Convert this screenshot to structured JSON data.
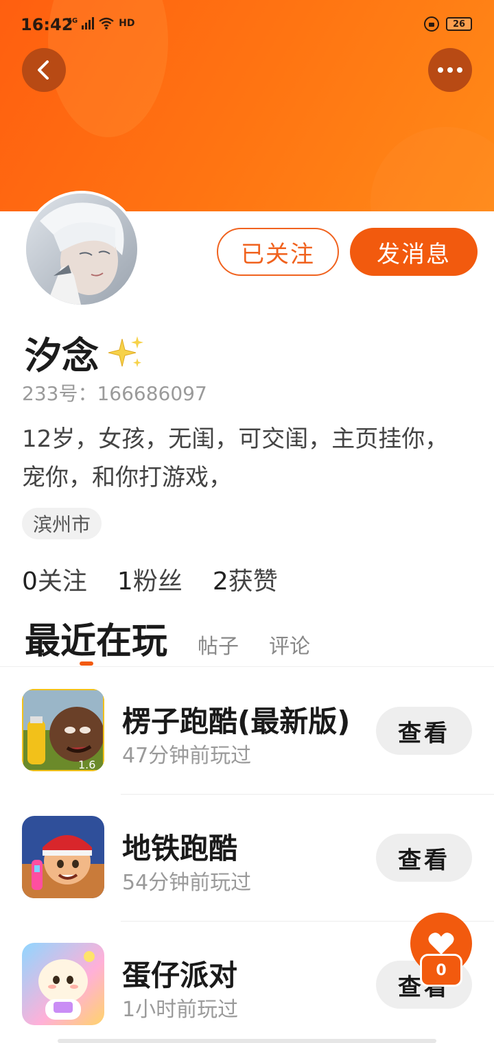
{
  "status_bar": {
    "time": "16:42",
    "network": "4G",
    "hd": "HD",
    "battery": "26"
  },
  "profile": {
    "follow_label": "已关注",
    "message_label": "发消息",
    "name": "汐念",
    "id": "233号：166686097",
    "bio": "12岁，女孩，无闺，可交闺，主页挂你，宠你，和你打游戏，",
    "location": "滨州市",
    "stats": [
      {
        "value": "0",
        "label": "关注"
      },
      {
        "value": "1",
        "label": "粉丝"
      },
      {
        "value": "2",
        "label": "获赞"
      }
    ]
  },
  "tabs": {
    "active": "最近在玩",
    "items": [
      "帖子",
      "评论"
    ]
  },
  "games": [
    {
      "name": "楞子跑酷(最新版)",
      "time": "47分钟前玩过",
      "button": "查看"
    },
    {
      "name": "地铁跑酷",
      "time": "54分钟前玩过",
      "button": "查看"
    },
    {
      "name": "蛋仔派对",
      "time": "1小时前玩过",
      "button": "查看"
    }
  ],
  "fab_badge": "0",
  "colors": {
    "accent": "#f25a0e",
    "banner": "#ff6a12"
  }
}
